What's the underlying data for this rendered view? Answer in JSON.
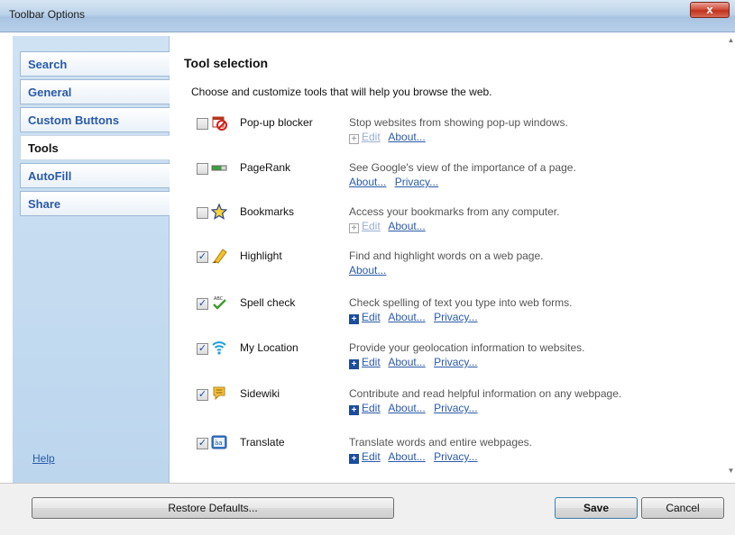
{
  "window": {
    "title": "Toolbar Options",
    "close_label": "x"
  },
  "sidebar": {
    "tabs": [
      {
        "label": "Search",
        "active": false
      },
      {
        "label": "General",
        "active": false
      },
      {
        "label": "Custom Buttons",
        "active": false
      },
      {
        "label": "Tools",
        "active": true
      },
      {
        "label": "AutoFill",
        "active": false
      },
      {
        "label": "Share",
        "active": false
      }
    ],
    "help_label": "Help"
  },
  "main": {
    "title": "Tool selection",
    "subtitle": "Choose and customize tools that will help you browse the web.",
    "tools": [
      {
        "name": "Pop-up blocker",
        "checked": false,
        "icon": "popup-blocker-icon",
        "description": "Stop websites from showing pop-up windows.",
        "links": [
          "Edit",
          "About..."
        ],
        "edit_enabled": false
      },
      {
        "name": "PageRank",
        "checked": false,
        "icon": "pagerank-icon",
        "description": "See Google's view of the importance of a page.",
        "links": [
          "About...",
          "Privacy..."
        ]
      },
      {
        "name": "Bookmarks",
        "checked": false,
        "icon": "star-icon",
        "description": "Access your bookmarks from any computer.",
        "links": [
          "Edit",
          "About..."
        ],
        "edit_enabled": false
      },
      {
        "name": "Highlight",
        "checked": true,
        "icon": "highlighter-icon",
        "description": "Find and highlight words on a web page.",
        "links": [
          "About..."
        ]
      },
      {
        "name": "Spell check",
        "checked": true,
        "icon": "spell-check-icon",
        "description": "Check spelling of text you type into web forms.",
        "links": [
          "Edit",
          "About...",
          "Privacy..."
        ],
        "edit_enabled": true
      },
      {
        "name": "My Location",
        "checked": true,
        "icon": "location-wifi-icon",
        "description": "Provide your geolocation information to websites.",
        "links": [
          "Edit",
          "About...",
          "Privacy..."
        ],
        "edit_enabled": true
      },
      {
        "name": "Sidewiki",
        "checked": true,
        "icon": "speech-bubble-icon",
        "description": "Contribute and read helpful information on any webpage.",
        "links": [
          "Edit",
          "About...",
          "Privacy..."
        ],
        "edit_enabled": true
      },
      {
        "name": "Translate",
        "checked": true,
        "icon": "translate-icon",
        "description": "Translate words and entire webpages.",
        "links": [
          "Edit",
          "About...",
          "Privacy..."
        ],
        "edit_enabled": true
      }
    ]
  },
  "footer": {
    "restore_label": "Restore Defaults...",
    "save_label": "Save",
    "cancel_label": "Cancel"
  },
  "colors": {
    "link": "#2a5aa8",
    "nav_bg": "#cfe2f3",
    "titlebar": "#bcd3ea",
    "close": "#c1321c"
  }
}
